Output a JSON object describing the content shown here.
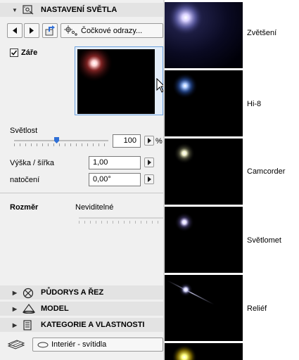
{
  "header": {
    "title": "NASTAVENÍ SVĚTLA",
    "lens_flare_button": "Čočkové odrazy..."
  },
  "glow": {
    "label": "Záře",
    "checked": true
  },
  "brightness": {
    "label": "Světlost",
    "value": "100",
    "unit": "%",
    "level": 0.45
  },
  "height_width": {
    "label": "Výška / šířka",
    "value": "1,00"
  },
  "rotation": {
    "label": "natočení",
    "value": "0,00°"
  },
  "size": {
    "label": "Rozměr",
    "value": "Neviditelné"
  },
  "sections": [
    {
      "title": "PŮDORYS A ŘEZ",
      "icon": "floorplan-section-icon"
    },
    {
      "title": "MODEL",
      "icon": "model-icon"
    },
    {
      "title": "KATEGORIE A VLASTNOSTI",
      "icon": "category-properties-icon"
    }
  ],
  "footer": {
    "layer": "Interiér - svítidla"
  },
  "presets": [
    {
      "label": "Zvětšení",
      "color": "#c8c8ff"
    },
    {
      "label": "Hi-8",
      "color": "#6aa0ff"
    },
    {
      "label": "Camcorder",
      "color": "#f0f0c8"
    },
    {
      "label": "Světlomet",
      "color": "#e0d8ff"
    },
    {
      "label": "Reliéf",
      "color": "#d8d8ff"
    },
    {
      "label": "",
      "color": "#ffee44"
    }
  ],
  "colors": {
    "panel_bg": "#f0f0f0",
    "header_bg": "#e3e3e3",
    "accent": "#2f6fd6",
    "preview_glow": "#ff8c8c"
  }
}
